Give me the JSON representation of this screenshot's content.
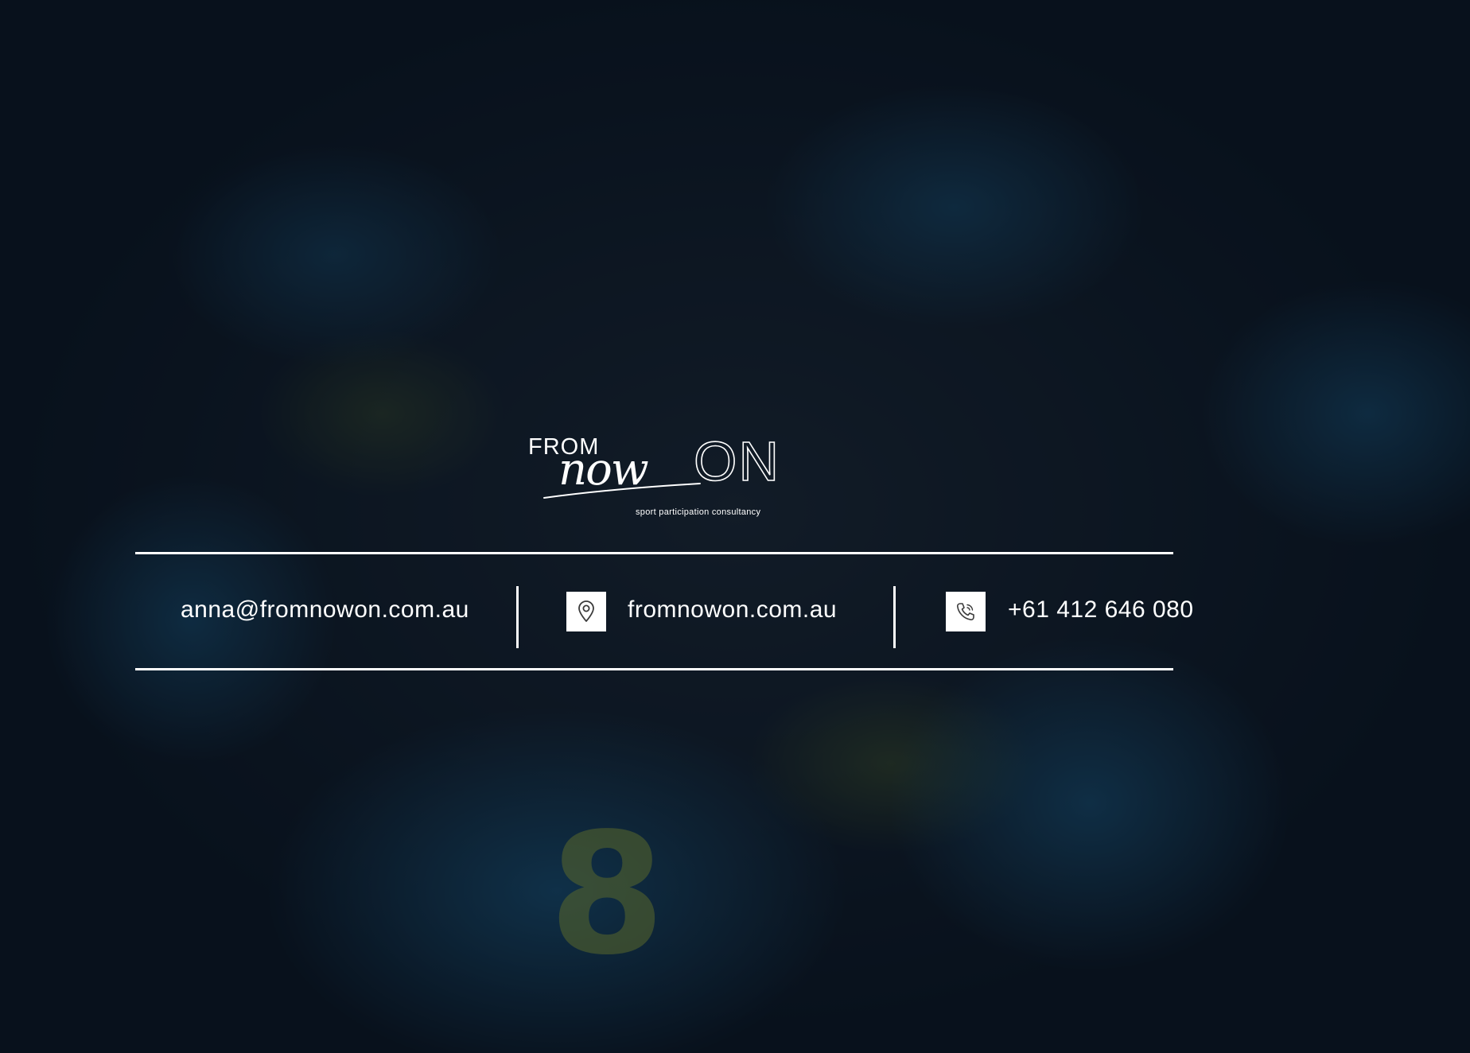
{
  "brand": {
    "logo_from": "FROM",
    "logo_now": "now",
    "logo_on": "ON",
    "tagline": "sport participation consultancy"
  },
  "background": {
    "jersey_number": "8"
  },
  "contact": {
    "email": "anna@fromnowon.com.au",
    "website": "fromnowon.com.au",
    "phone": "+61 412 646 080"
  },
  "icons": {
    "website_icon": "location-pin-icon",
    "phone_icon": "phone-icon"
  },
  "colors": {
    "overlay": "#08101e",
    "text": "#ffffff",
    "jersey_blue": "#248cc8",
    "jersey_green": "#aac828"
  }
}
